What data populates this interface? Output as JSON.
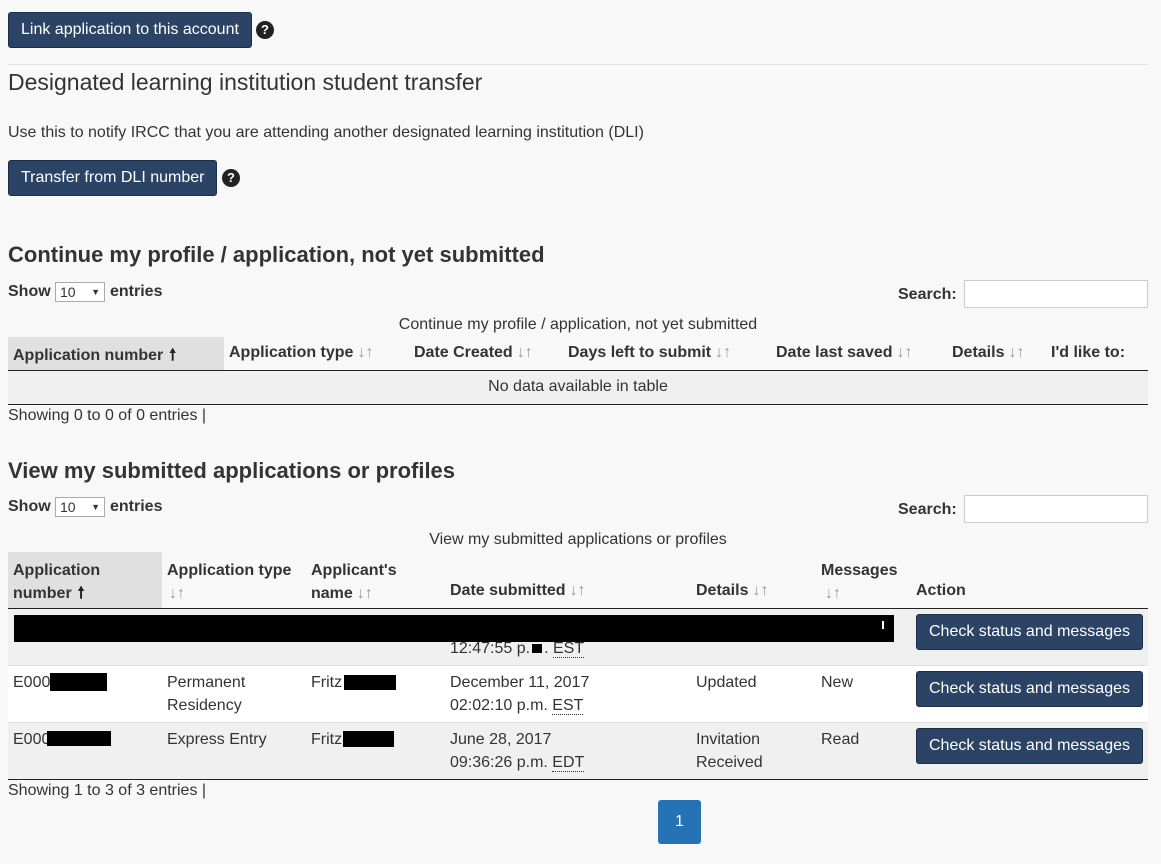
{
  "top": {
    "link_button": "Link application to this account",
    "dli_title": "Designated learning institution student transfer",
    "dli_description": "Use this to notify IRCC that you are attending another designated learning institution (DLI)",
    "transfer_button": "Transfer from DLI number",
    "help_icon": "question-circle-icon"
  },
  "unsubmitted": {
    "title": "Continue my profile / application, not yet submitted",
    "show_label": "Show",
    "show_value": "10",
    "entries_label": "entries",
    "search_label": "Search:",
    "search_value": "",
    "caption": "Continue my profile / application, not yet submitted",
    "headers": [
      "Application number",
      "Application type",
      "Date Created",
      "Days left to submit",
      "Date last saved",
      "Details",
      "I'd like to:"
    ],
    "empty_message": "No data available in table",
    "info": "Showing 0 to 0 of 0 entries"
  },
  "submitted": {
    "title": "View my submitted applications or profiles",
    "show_label": "Show",
    "show_value": "10",
    "entries_label": "entries",
    "search_label": "Search:",
    "search_value": "",
    "caption": "View my submitted applications or profiles",
    "headers": {
      "app_number_1": "Application",
      "app_number_2": "number",
      "app_type": "Application type",
      "name_1": "Applicant's",
      "name_2": "name",
      "date": "Date submitted",
      "details": "Details",
      "messages": "Messages",
      "action": "Action"
    },
    "rows": [
      {
        "app_number": "",
        "app_type": "",
        "name": "",
        "time": "12:47:55 p.",
        "time_tail": ".",
        "tz": "EST",
        "details": "",
        "messages": "",
        "action": "Check status and messages"
      },
      {
        "app_number": "E000",
        "app_type_1": "Permanent",
        "app_type_2": "Residency",
        "name": "Fritz",
        "date": "December 11, 2017",
        "time": "02:02:10 p.m.",
        "tz": "EST",
        "details": "Updated",
        "messages": "New",
        "action": "Check status and messages"
      },
      {
        "app_number": "E000",
        "app_type": "Express Entry",
        "name": "Fritz",
        "date": "June 28, 2017",
        "time": "09:36:26 p.m.",
        "tz": "EDT",
        "details_1": "Invitation",
        "details_2": "Received",
        "messages": "Read",
        "action": "Check status and messages"
      }
    ],
    "info": "Showing 1 to 3 of 3 entries",
    "page": "1"
  },
  "colors": {
    "primary_button": "#2b4466",
    "page_button": "#2572b4",
    "sorted_header_bg": "#e0e0e0",
    "background": "#f8f8f8"
  }
}
